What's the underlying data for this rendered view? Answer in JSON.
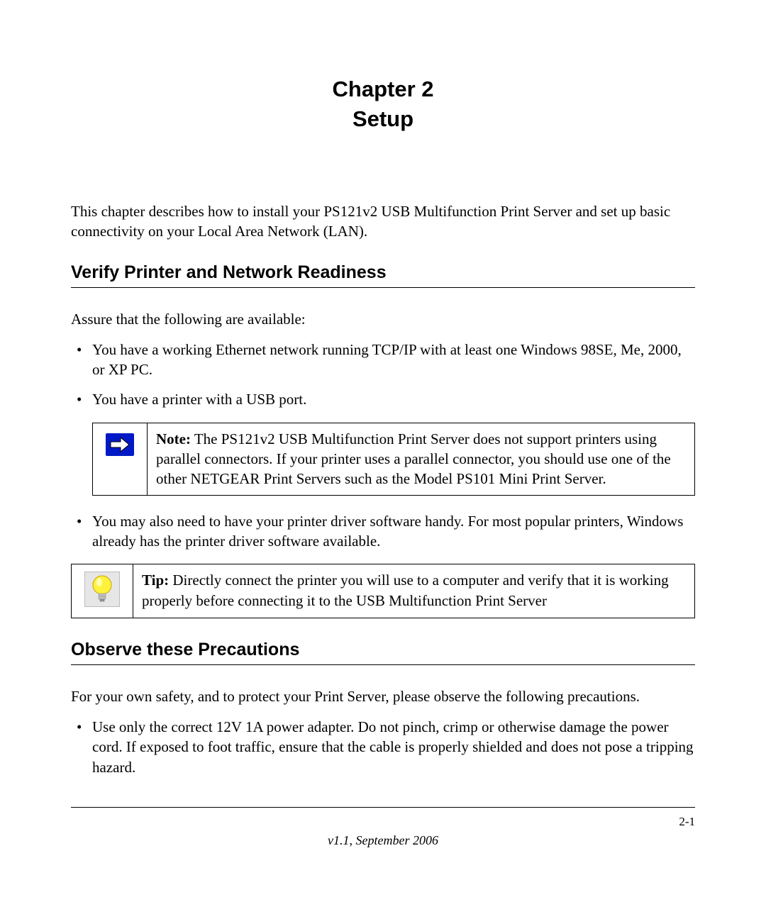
{
  "chapter": {
    "line1": "Chapter 2",
    "line2": "Setup"
  },
  "intro": "This chapter describes how to install your  PS121v2 USB Multifunction Print Server and set up basic connectivity on your Local Area Network (LAN).",
  "section1": {
    "heading": "Verify Printer and Network Readiness",
    "lead": "Assure that the following are available:",
    "bullets_a": [
      "You have a working Ethernet network running TCP/IP with at least one Windows 98SE, Me, 2000, or XP PC.",
      "You have a printer with a USB port."
    ],
    "note": {
      "label": "Note:",
      "text": " The  PS121v2 USB Multifunction Print Server does not support printers using parallel connectors. If your printer uses a parallel connector, you should use one of the other NETGEAR Print Servers such as the Model PS101 Mini Print Server."
    },
    "bullets_b": [
      "You may also need to have your printer driver software handy. For most popular printers, Windows already has the printer driver software available."
    ],
    "tip": {
      "label": "Tip:",
      "text": " Directly connect the printer you will use to a computer and verify that it is working properly before connecting it to the USB Multifunction Print Server"
    }
  },
  "section2": {
    "heading": "Observe these Precautions",
    "lead": "For your own safety, and to protect your Print Server, please observe the following precautions.",
    "bullets": [
      "Use only the correct 12V 1A power adapter. Do not pinch, crimp or otherwise damage the power cord. If exposed to foot traffic, ensure that the cable is properly shielded and does not pose a tripping hazard."
    ]
  },
  "footer": {
    "page": "2-1",
    "version": "v1.1, September 2006"
  }
}
